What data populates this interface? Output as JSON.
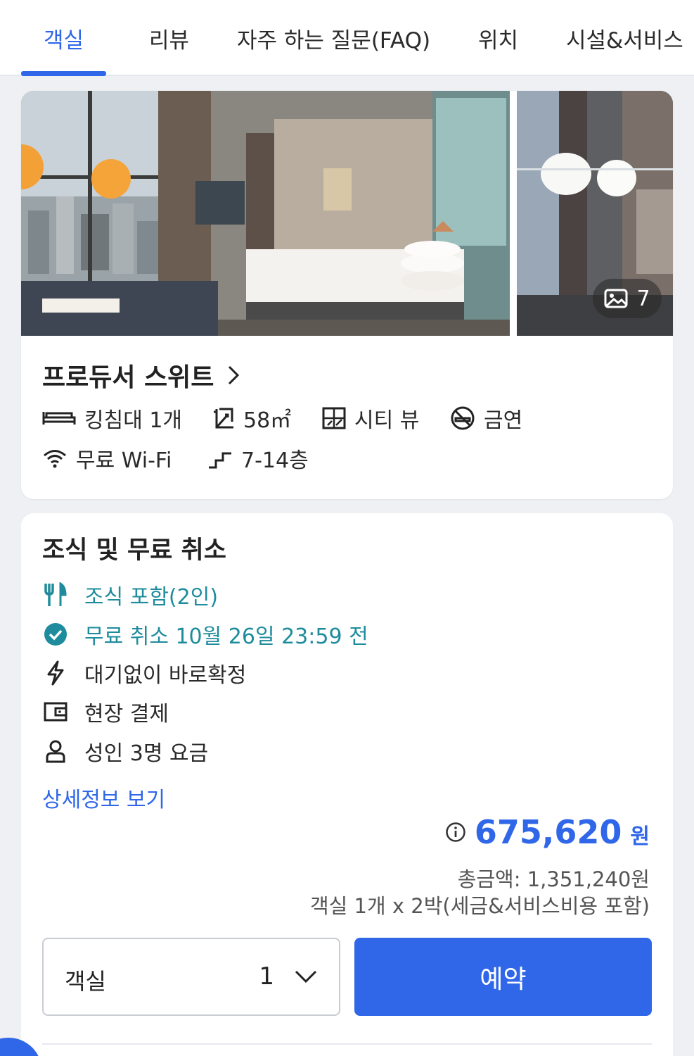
{
  "tabs": [
    {
      "label": "객실",
      "active": true
    },
    {
      "label": "리뷰",
      "active": false
    },
    {
      "label": "자주 하는 질문(FAQ)",
      "active": false
    },
    {
      "label": "위치",
      "active": false
    },
    {
      "label": "시설&서비스",
      "active": false
    }
  ],
  "room": {
    "name": "프로듀서 스위트",
    "photo_count": "7",
    "features": {
      "bed": "킹침대 1개",
      "size": "58㎡",
      "view": "시티 뷰",
      "smoking": "금연",
      "wifi": "무료 Wi-Fi",
      "floor": "7-14층"
    }
  },
  "plan": {
    "title": "조식 및 무료 취소",
    "breakfast": "조식 포함(2인)",
    "cancellation": "무료 취소 10월 26일 23:59 전",
    "instant": "대기없이 바로확정",
    "payment": "현장 결제",
    "guests": "성인 3명 요금",
    "details_link": "상세정보 보기",
    "price": "675,620",
    "price_unit": "원",
    "total": "총금액: 1,351,240원",
    "per": "객실 1개 x 2박(세금&서비스비용 포함)",
    "room_select_label": "객실",
    "room_select_value": "1",
    "book_label": "예약"
  },
  "colors": {
    "accent": "#2f67e8",
    "teal": "#1e8c9c"
  }
}
